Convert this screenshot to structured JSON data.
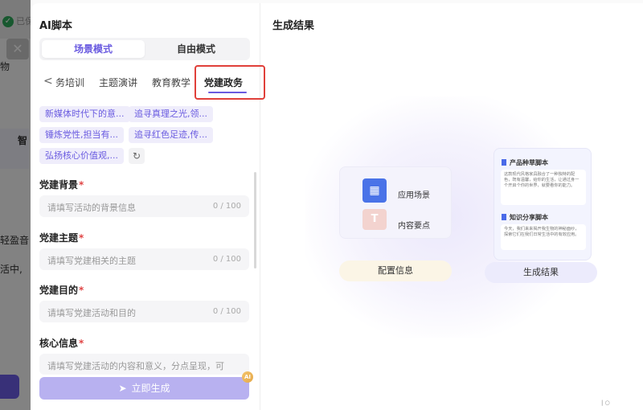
{
  "background": {
    "saved_text": "已保",
    "side_texts": [
      "物",
      "智",
      "轻盈音",
      "活中,"
    ]
  },
  "modal": {
    "title": "AI脚本",
    "modes": {
      "scene": "场景模式",
      "free": "自由模式"
    },
    "categories": [
      "务培训",
      "主题演讲",
      "教育教学",
      "党建政务"
    ],
    "suggestions": [
      "新媒体时代下的意...",
      "追寻真理之光,领...",
      "锤炼党性,担当有...",
      "追寻红色足迹,传...",
      "弘扬核心价值观,..."
    ],
    "fields": [
      {
        "label": "党建背景",
        "required": "*",
        "placeholder": "请填写活动的背景信息",
        "count": "0 / 100"
      },
      {
        "label": "党建主题",
        "required": "*",
        "placeholder": "请填写党建相关的主题",
        "count": "0 / 100"
      },
      {
        "label": "党建目的",
        "required": "*",
        "placeholder": "请填写党建活动和目的",
        "count": "0 / 100"
      },
      {
        "label": "核心信息",
        "required": "*",
        "placeholder": "请填写党建活动的内容和意义，分点呈现，可",
        "count": ""
      }
    ],
    "generate_button": "立即生成",
    "ai_badge": "AI"
  },
  "result": {
    "title": "生成结果",
    "config": {
      "scene_label": "应用场景",
      "points_label": "内容要点",
      "tag": "配置信息"
    },
    "output": {
      "card1_title": "产品种草脚本",
      "card1_text": "这款现代风格家具融合了一种独特的配色，既有温馨，给你的生活，让通过身一个开启个你的世界，就要看你的能力。",
      "card2_title": "知识分享脚本",
      "card2_text": "今天，我们来来揭开我生物的神秘面纱，探索它们在我们日常生活中的有效应用。",
      "tag": "生成结果"
    },
    "corner": "| ○"
  },
  "colors": {
    "accent": "#6a5be0",
    "highlight": "#e0403a",
    "button_disabled": "#b8b1f0"
  }
}
